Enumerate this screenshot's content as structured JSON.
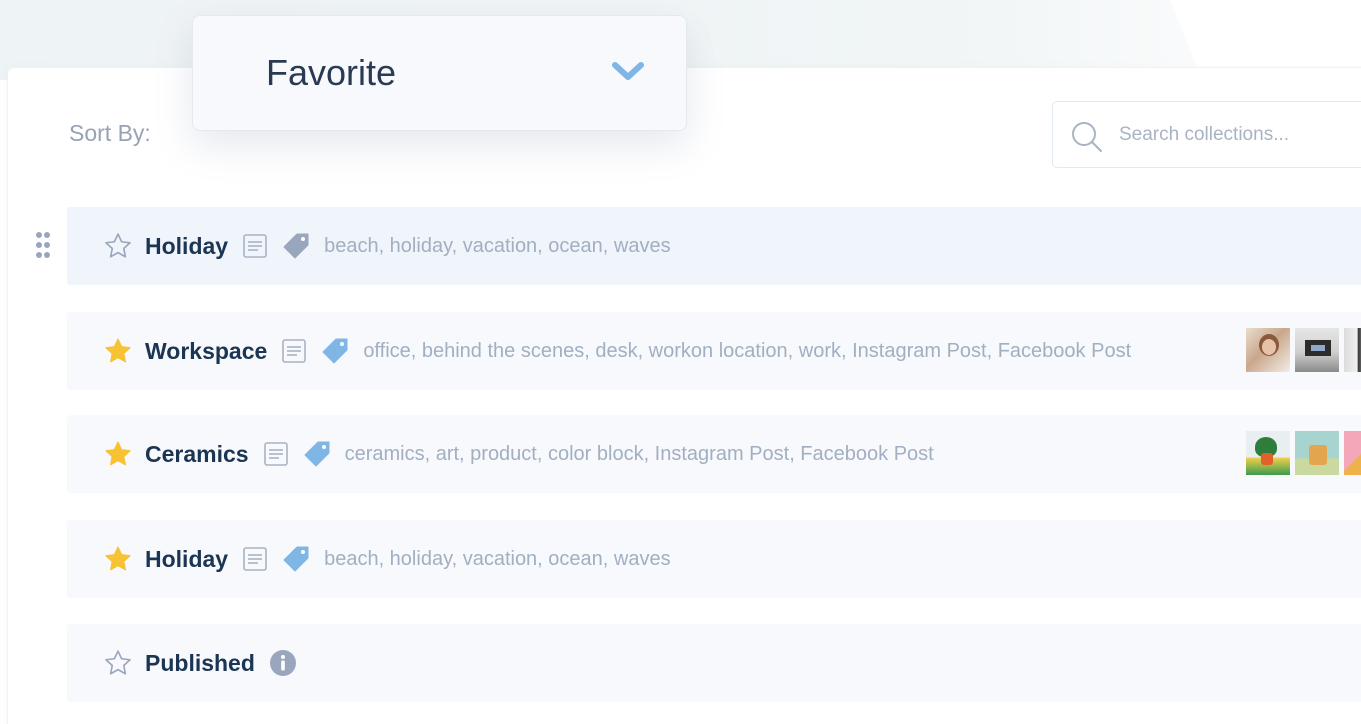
{
  "sort": {
    "label": "Sort By:",
    "selected": "Favorite"
  },
  "search": {
    "placeholder": "Search collections..."
  },
  "colors": {
    "star_active": "#f7c233",
    "star_inactive": "#9aa6bd",
    "title": "#1b3553",
    "tags_text": "#a2afc1",
    "row_bg": "#f7f9fd",
    "chevron": "#7fb6e6"
  },
  "collections": [
    {
      "title": "Holiday",
      "favorite": false,
      "icons": [
        "note-icon",
        "tag-icon"
      ],
      "tags": "beach, holiday, vacation, ocean, waves",
      "thumbnails": []
    },
    {
      "title": "Workspace",
      "favorite": true,
      "icons": [
        "note-icon",
        "tag-icon"
      ],
      "tags": "office, behind the scenes, desk, workon location, work, Instagram Post, Facebook Post",
      "thumbnails": [
        "portrait-photo",
        "desk-monitor-photo",
        "office-photo"
      ]
    },
    {
      "title": "Ceramics",
      "favorite": true,
      "icons": [
        "note-icon",
        "tag-icon"
      ],
      "tags": "ceramics, art, product, color block, Instagram Post, Facebook Post",
      "thumbnails": [
        "plant-vase-photo",
        "ceramic-cup-photo",
        "pink-product-photo"
      ]
    },
    {
      "title": "Holiday",
      "favorite": true,
      "icons": [
        "note-icon",
        "tag-icon"
      ],
      "tags": "beach, holiday, vacation, ocean, waves",
      "thumbnails": []
    },
    {
      "title": "Published",
      "favorite": false,
      "icons": [
        "info-icon"
      ],
      "tags": "",
      "thumbnails": []
    }
  ]
}
